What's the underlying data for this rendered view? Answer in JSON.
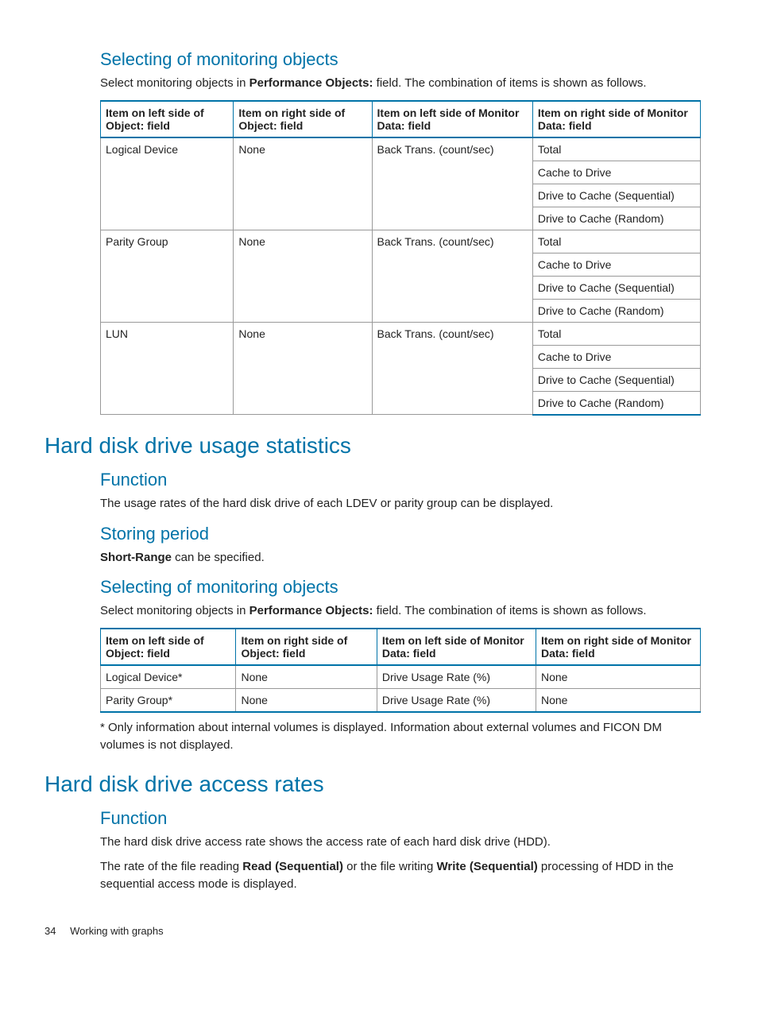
{
  "sections": {
    "selecting1": {
      "title": "Selecting of monitoring objects",
      "para_a": "Select monitoring objects in ",
      "para_bold": "Performance Objects:",
      "para_b": " field. The combination of items is shown as follows."
    },
    "hdd_usage": {
      "title": "Hard disk drive usage statistics",
      "function_title": "Function",
      "function_text": "The usage rates of the hard disk drive of each LDEV or parity group can be displayed.",
      "storing_title": "Storing period",
      "storing_bold": "Short-Range",
      "storing_rest": " can be specified.",
      "selecting_title": "Selecting of monitoring objects",
      "selecting_a": "Select monitoring objects in ",
      "selecting_bold": "Performance Objects:",
      "selecting_b": " field. The combination of items is shown as follows.",
      "note": "* Only information about internal volumes is displayed. Information about external volumes and FICON DM volumes is not displayed."
    },
    "hdd_access": {
      "title": "Hard disk drive access rates",
      "function_title": "Function",
      "p1": "The hard disk drive access rate shows the access rate of each hard disk drive (HDD).",
      "p2_a": "The rate of the file reading ",
      "p2_b1": "Read (Sequential)",
      "p2_c": " or the file writing ",
      "p2_b2": "Write (Sequential)",
      "p2_d": " processing of HDD in the sequential access mode is displayed."
    }
  },
  "table1": {
    "headers": [
      "Item on left side of Object: field",
      "Item on right side of Object: field",
      "Item on left side of Monitor Data: field",
      "Item on right side of Monitor Data: field"
    ],
    "groups": [
      {
        "left": "Logical Device",
        "right": "None",
        "monitor": "Back Trans. (count/sec)",
        "values": [
          "Total",
          "Cache to Drive",
          "Drive to Cache (Sequential)",
          "Drive to Cache (Random)"
        ]
      },
      {
        "left": "Parity Group",
        "right": "None",
        "monitor": "Back Trans. (count/sec)",
        "values": [
          "Total",
          "Cache to Drive",
          "Drive to Cache (Sequential)",
          "Drive to Cache (Random)"
        ]
      },
      {
        "left": "LUN",
        "right": "None",
        "monitor": "Back Trans. (count/sec)",
        "values": [
          "Total",
          "Cache to Drive",
          "Drive to Cache (Sequential)",
          "Drive to Cache (Random)"
        ]
      }
    ]
  },
  "table2": {
    "headers": [
      "Item on left side of Object: field",
      "Item on right side of Object: field",
      "Item on left side of Monitor Data: field",
      "Item on right side of Monitor Data: field"
    ],
    "rows": [
      [
        "Logical Device*",
        "None",
        "Drive Usage Rate (%)",
        "None"
      ],
      [
        "Parity Group*",
        "None",
        "Drive Usage Rate (%)",
        "None"
      ]
    ]
  },
  "footer": {
    "page": "34",
    "label": "Working with graphs"
  }
}
